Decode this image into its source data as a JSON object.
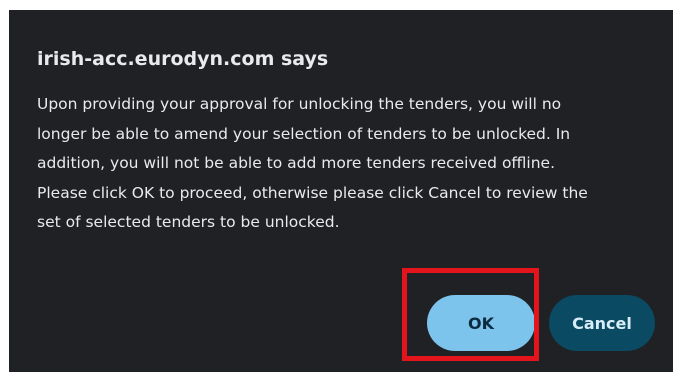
{
  "dialog": {
    "title": "irish-acc.eurodyn.com says",
    "message": "Upon providing your approval for unlocking the tenders, you will no\nlonger be able to amend your selection of tenders to be unlocked. In\naddition, you will not be able to add more tenders received offline.\nPlease click OK to proceed, otherwise please click Cancel to review the\nset of selected tenders to be unlocked.",
    "ok_label": "OK",
    "cancel_label": "Cancel"
  },
  "colors": {
    "dialog_background": "#202124",
    "text": "#e8eaed",
    "ok_button": "#7cc4ec",
    "cancel_button": "#0a4a63",
    "highlight": "#e3141b"
  }
}
